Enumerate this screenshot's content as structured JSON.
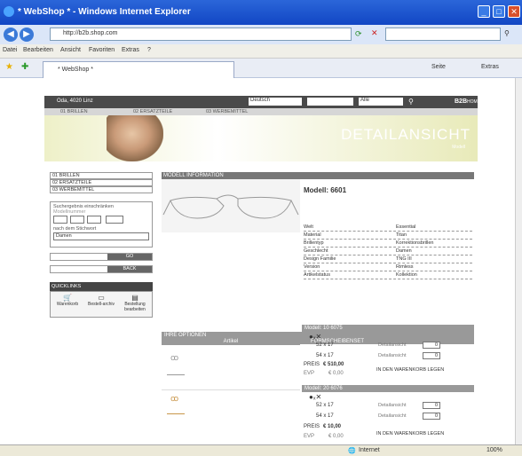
{
  "window": {
    "title": "* WebShop * - Windows Internet Explorer"
  },
  "address": {
    "url": "http://b2b.shop.com"
  },
  "menu": [
    "Datei",
    "Bearbeiten",
    "Ansicht",
    "Favoriten",
    "Extras",
    "?"
  ],
  "tab": {
    "label": "* WebShop *"
  },
  "toolbar": {
    "seite": "Seite",
    "extras": "Extras"
  },
  "status": {
    "zone": "Internet",
    "zoom": "100%"
  },
  "header": {
    "location": "Oda, 4020 Linz",
    "language": "Deutsch",
    "category": "Alle",
    "b2b": "B2B",
    "home": "HOME",
    "nav": [
      "01 BRILLEN",
      "02 ERSATZTEILE",
      "03 WERBEMITTEL"
    ]
  },
  "hero": {
    "title": "DETAILANSICHT",
    "sub": "Modell"
  },
  "sidebar": {
    "items": [
      "01 BRILLEN",
      "02 ERSATZTEILE",
      "03 WERBEMITTEL"
    ],
    "search_title": "Suchergebnis einschränken",
    "model_label": "Modellnummer",
    "keyword_label": "nach dem Stichwort",
    "select_value": "Damen",
    "go": "GO",
    "back": "BACK",
    "quicklinks": "QUICKLINKS",
    "ql": [
      "Warenkorb",
      "Bestell-archiv",
      "Bestellung bearbeiten"
    ]
  },
  "model": {
    "header": "MODELL INFORMATION",
    "name": "Modell: 6601",
    "attrs": [
      [
        "Welt",
        "Essential"
      ],
      [
        "Material",
        "Titan"
      ],
      [
        "Brillentyp",
        "Korrektionsbrillen"
      ],
      [
        "Geschlecht",
        "Damen"
      ],
      [
        "Design Familie",
        "TNG III"
      ],
      [
        "Version",
        "Rimless"
      ],
      [
        "Artikelstatus",
        "Kollektion"
      ]
    ]
  },
  "options": {
    "header": "IHRE OPTIONEN",
    "artikel": "Artikel",
    "formscheibe": "FORMSCHEIBENSET",
    "cart": "IN DEN WARENKORB LEGEN",
    "detail": "Detailansicht",
    "preis": "PREIS",
    "evp": "EVP",
    "items": [
      {
        "title": "Modell: 10 6075",
        "sizes": [
          "52 x 17",
          "54 x 17"
        ],
        "qty": [
          "0",
          "0"
        ],
        "preis": "€ 510,00",
        "evp": "€ 0,00"
      },
      {
        "title": "Modell: 20 6076",
        "sizes": [
          "52 x 17",
          "54 x 17"
        ],
        "qty": [
          "0",
          "0"
        ],
        "preis": "€ 10,00",
        "evp": "€ 0,00"
      }
    ]
  }
}
